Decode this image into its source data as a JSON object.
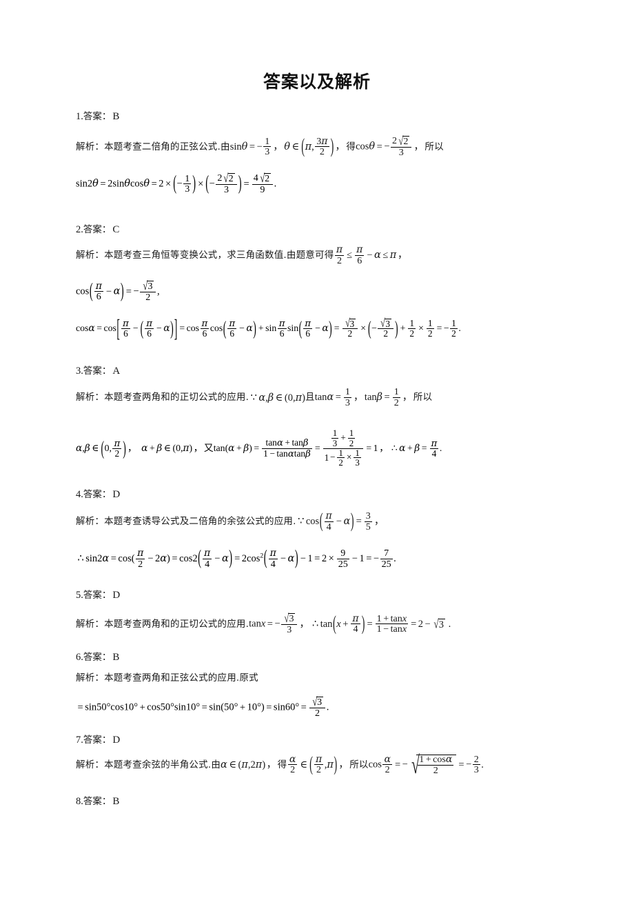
{
  "document": {
    "title": "答案以及解析",
    "answer_label": "答案：",
    "analysis_label": "解析：",
    "sections": [
      {
        "number": "1.",
        "answer": "B",
        "analysis_text": "本题考查二倍角的正弦公式.",
        "analysis_tail": "所以",
        "formulas": [
          "由 sinθ = −1/3 , θ ∈ (π, 3π/2) , 得 cosθ = −2√2/3 ,",
          "sin2θ = 2 sinθ cosθ = 2 × (−1/3) × (−2√2/3) = 4√2/9 ."
        ]
      },
      {
        "number": "2.",
        "answer": "C",
        "analysis_text": "本题考查三角恒等变换公式，求三角函数值.",
        "analysis_tail": "",
        "formulas": [
          "由题意可得 π/2 ≤ π/6 − α ≤ π ,",
          "cos(π/6 − α) = −√3/2 ,",
          "cosα = cos[π/6 − (π/6 − α)] = cos π/6 cos(π/6 − α) + sin π/6 sin(π/6 − α) = √3/2 × (−√3/2) + 1/2 × 1/2 = −1/2 ."
        ]
      },
      {
        "number": "3.",
        "answer": "A",
        "analysis_text": "本题考查两角和的正切公式的应用.",
        "analysis_tail": "所以",
        "formulas": [
          "∵ α,β ∈ (0,π) 且 tanα = 1/3 , tanβ = 1/2 ,",
          "α,β ∈ (0, π/2) , α + β ∈ (0,π) , 又 tan(α + β) = (tanα + tanβ)/(1 − tanα tanβ) = (1/3 + 1/2)/(1 − 1/2 × 1/3) = 1 , ∴ α + β = π/4 ."
        ]
      },
      {
        "number": "4.",
        "answer": "D",
        "analysis_text": "本题考查诱导公式及二倍角的余弦公式的应用.",
        "analysis_tail": "",
        "formulas": [
          "∵ cos(π/4 − α) = 3/5 ,",
          "∴ sin2α = cos(π/2 − 2α) = cos2(π/4 − α) = 2cos²(π/4 − α) − 1 = 2 × 9/25 − 1 = −7/25 ."
        ]
      },
      {
        "number": "5.",
        "answer": "D",
        "analysis_text": "本题考查两角和的正切公式的应用.",
        "analysis_tail": "",
        "formulas": [
          "tan x = −√3/3 , ∴ tan(x + π/4) = (1 + tan x)/(1 − tan x) = 2 − √3 ."
        ]
      },
      {
        "number": "6.",
        "answer": "B",
        "analysis_text": "本题考查两角和正弦公式的应用.",
        "analysis_tail": "原式",
        "formulas": [
          "= sin50°cos10° + cos50°sin10° = sin(50° + 10°) = sin60° = √3/2 ."
        ]
      },
      {
        "number": "7.",
        "answer": "D",
        "analysis_text": "本题考查余弦的半角公式.",
        "analysis_tail": "",
        "formulas": [
          "由 α ∈ (π, 2π) , 得 α/2 ∈ (π/2, π) , 所以 cos α/2 = −√((1 + cosα)/2) = −2/3 ."
        ]
      },
      {
        "number": "8.",
        "answer": "B",
        "analysis_text": "",
        "analysis_tail": "",
        "formulas": []
      }
    ],
    "inline_words": {
      "you": "由",
      "de": "得",
      "suoyi": "所以",
      "youtiyi": "由题意可得",
      "qie": "且",
      "you2": "又",
      "yuanshi": "原式"
    }
  }
}
